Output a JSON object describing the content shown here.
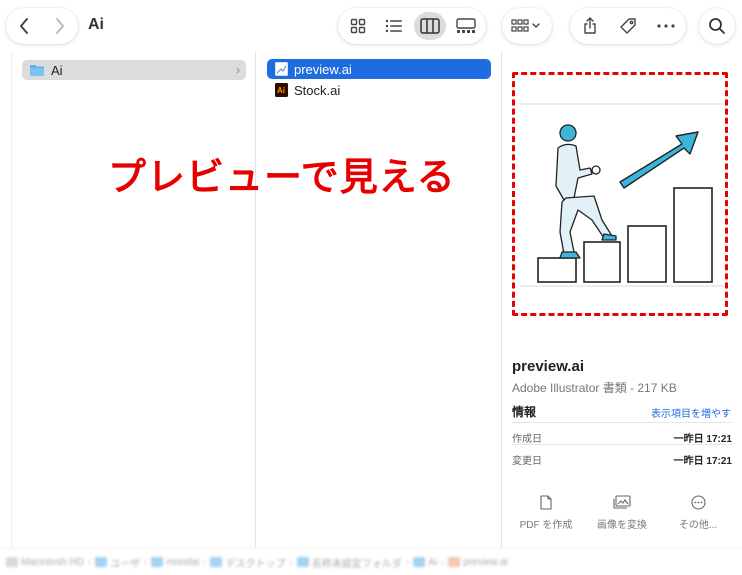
{
  "toolbar": {
    "title": "Ai",
    "back_icon": "chevron-left-icon",
    "forward_icon": "chevron-right-icon",
    "views": [
      "icon-view",
      "list-view",
      "column-view",
      "gallery-view"
    ],
    "active_view": "column-view",
    "group_icon": "group-by-icon",
    "actions": [
      "share-icon",
      "tag-icon",
      "more-icon"
    ],
    "search_icon": "search-icon"
  },
  "sidebar_column": {
    "items": [
      {
        "label": "Ai",
        "icon": "folder-icon"
      }
    ]
  },
  "file_column": {
    "items": [
      {
        "label": "preview.ai",
        "icon": "ai-preview-icon",
        "selected": true
      },
      {
        "label": "Stock.ai",
        "icon": "illustrator-file-icon",
        "selected": false
      }
    ]
  },
  "annotation": {
    "text": "プレビューで見える",
    "color": "#e60000"
  },
  "preview": {
    "file_name": "preview.ai",
    "kind": "Adobe Illustrator 書類 - 217 KB",
    "info_heading": "情報",
    "info_more": "表示項目を増やす",
    "info_rows": [
      {
        "key": "作成日",
        "value": "一昨日 17:21"
      },
      {
        "key": "変更日",
        "value": "一昨日 17:21"
      }
    ],
    "quick_actions": [
      {
        "label": "PDF を作成",
        "icon": "document-icon"
      },
      {
        "label": "画像を変換",
        "icon": "image-icon"
      },
      {
        "label": "その他...",
        "icon": "ellipsis-circle-icon"
      }
    ]
  },
  "path_bar": {
    "crumbs": [
      "Macintosh HD",
      "ユーザ",
      "mondai",
      "デスクトップ",
      "名称未設定フォルダ",
      "Ai",
      "preview.ai"
    ]
  },
  "colors": {
    "selection": "#1f6ce0",
    "accent_red": "#e60000",
    "folder": "#5eb0e8"
  }
}
